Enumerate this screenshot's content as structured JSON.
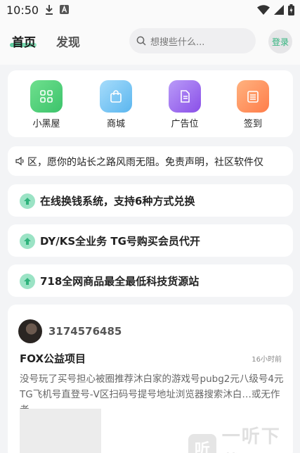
{
  "status_bar": {
    "time": "10:50"
  },
  "header": {
    "tabs": [
      {
        "label": "首页"
      },
      {
        "label": "发现"
      }
    ],
    "search_placeholder": "想搜些什么...",
    "login_label": "登录"
  },
  "quick_actions": [
    {
      "label": "小黑屋",
      "color": "#4fd07a"
    },
    {
      "label": "商城",
      "color": "#7cc8f4"
    },
    {
      "label": "广告位",
      "color": "#9f6cf0"
    },
    {
      "label": "签到",
      "color": "#ff8f57"
    }
  ],
  "notice": {
    "text": "区，愿你的站长之路风雨无阻。免责声明，社区软件仅"
  },
  "links": [
    {
      "text": "在线换钱系统，支持6种方式兑换"
    },
    {
      "text": "DY/KS全业务 TG号购买会员代开"
    },
    {
      "text": "718全网商品最全最低科技货源站"
    }
  ],
  "post": {
    "username": "3174576485",
    "title": "FOX公益项目",
    "time": "16小时前",
    "body": "没号玩了买号担心被圈推荐沐白家的游戏号pubg2元八级号4元TG飞机号直登号-V区扫码号提号地址浏览器搜索沐白…或无作者…"
  },
  "watermark": {
    "text": "一听下载",
    "logo_char": "听"
  }
}
